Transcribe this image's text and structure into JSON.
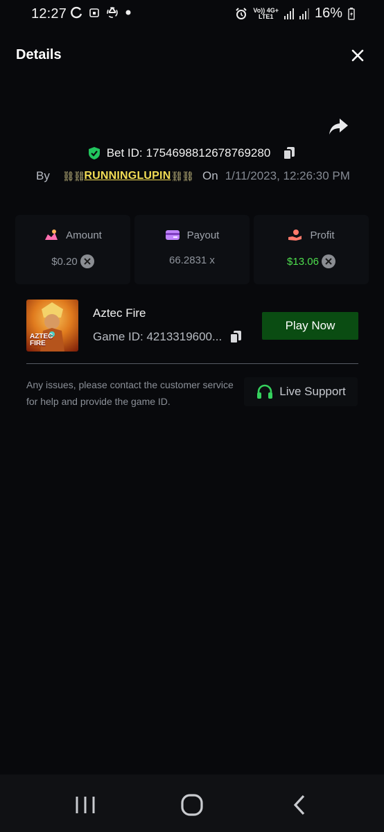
{
  "status_bar": {
    "time": "12:27",
    "network_top": "Vo)) 4G+",
    "network_bottom": "LTE1",
    "battery": "16%"
  },
  "header": {
    "title": "Details"
  },
  "bet": {
    "label": "Bet ID:",
    "id": "1754698812678769280",
    "by_label": "By",
    "chain": "⛓⛓",
    "user": "RUNNINGLUPIN",
    "on_label": "On",
    "datetime": "1/11/2023, 12:26:30 PM"
  },
  "stats": {
    "amount_label": "Amount",
    "amount_value": "$0.20",
    "payout_label": "Payout",
    "payout_value": "66.2831 x",
    "profit_label": "Profit",
    "profit_value": "$13.06"
  },
  "game": {
    "thumb_text_1": "AZTEC",
    "thumb_text_2": "FIRE",
    "name": "Aztec Fire",
    "id_text": "Game ID: 4213319600...",
    "play_label": "Play Now"
  },
  "support": {
    "text": "Any issues, please contact the customer service for help and provide the game ID.",
    "button_label": "Live Support"
  },
  "colors": {
    "accent_green": "#0a4c12",
    "profit_green": "#4ede4e",
    "username_yellow": "#f3dd55",
    "shield_green": "#22c55e"
  }
}
